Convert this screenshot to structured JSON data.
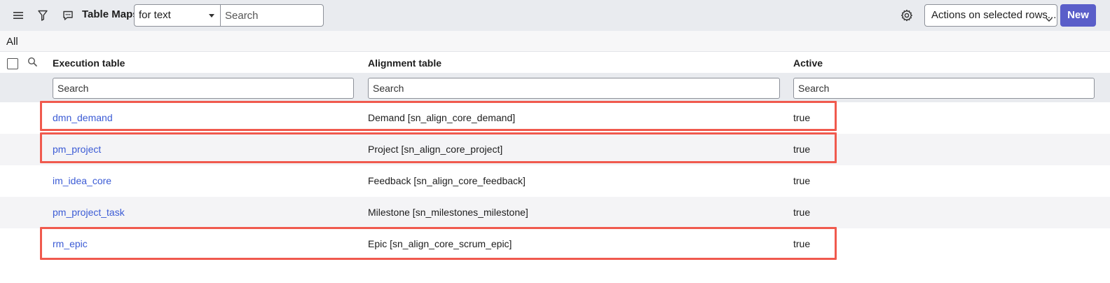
{
  "header": {
    "title": "Table Maps",
    "search_field": "for text",
    "search_placeholder": "Search",
    "actions_label": "Actions on selected rows...",
    "new_label": "New"
  },
  "breadcrumb": {
    "label": "All"
  },
  "columns": {
    "execution": "Execution table",
    "alignment": "Alignment table",
    "active": "Active"
  },
  "filters": {
    "execution_placeholder": "Search",
    "alignment_placeholder": "Search",
    "active_placeholder": "Search"
  },
  "rows": [
    {
      "execution": "dmn_demand",
      "alignment": "Demand [sn_align_core_demand]",
      "active": "true"
    },
    {
      "execution": "pm_project",
      "alignment": "Project [sn_align_core_project]",
      "active": "true"
    },
    {
      "execution": "im_idea_core",
      "alignment": "Feedback [sn_align_core_feedback]",
      "active": "true"
    },
    {
      "execution": "pm_project_task",
      "alignment": "Milestone [sn_milestones_milestone]",
      "active": "true"
    },
    {
      "execution": "rm_epic",
      "alignment": "Epic [sn_align_core_scrum_epic]",
      "active": "true"
    }
  ],
  "colors": {
    "accent": "#5a5ec9",
    "link": "#3b5bd5",
    "highlight": "#f05a4e"
  },
  "icons": [
    "hamburger-menu-icon",
    "filter-icon",
    "comment-icon",
    "gear-icon",
    "search-icon",
    "chevron-down-icon"
  ]
}
